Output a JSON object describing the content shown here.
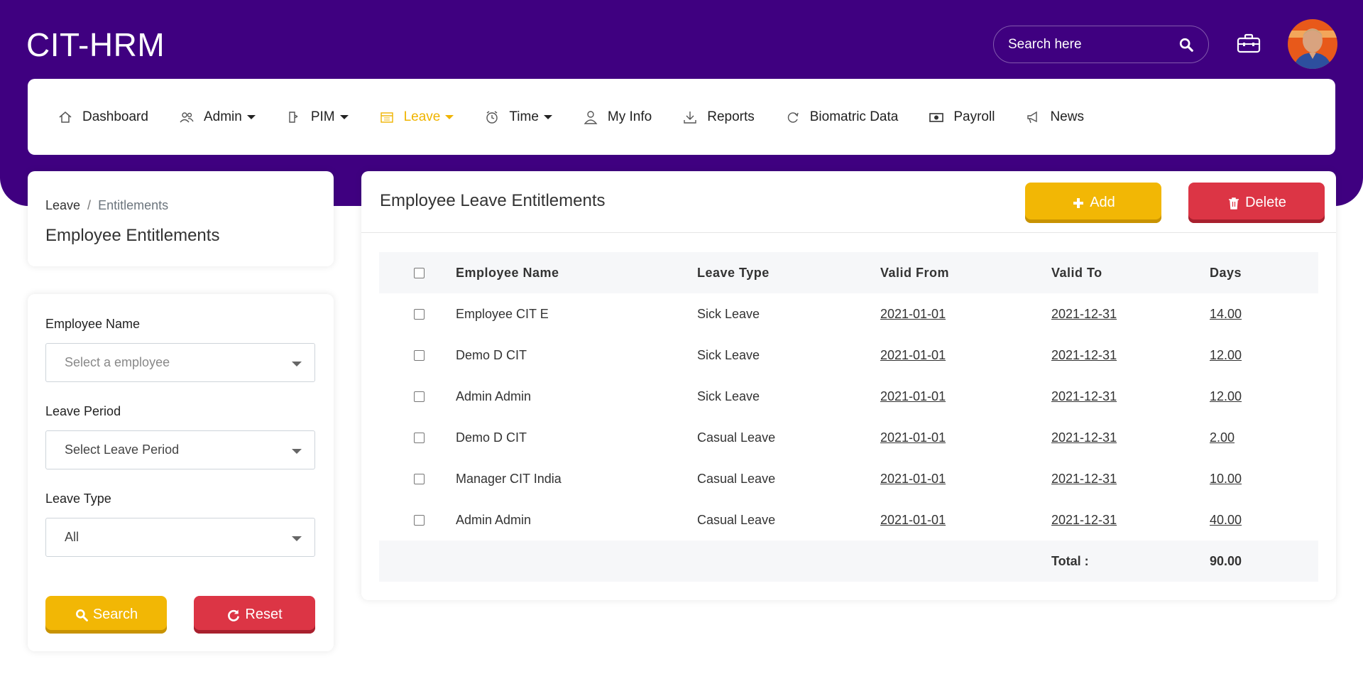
{
  "app": {
    "brand": "CIT-HRM"
  },
  "header": {
    "search_placeholder": "Search here"
  },
  "nav": [
    {
      "label": "Dashboard",
      "icon": "home-icon",
      "dropdown": false,
      "active": false
    },
    {
      "label": "Admin",
      "icon": "users-icon",
      "dropdown": true,
      "active": false
    },
    {
      "label": "PIM",
      "icon": "pim-icon",
      "dropdown": true,
      "active": false
    },
    {
      "label": "Leave",
      "icon": "calendar-icon",
      "dropdown": true,
      "active": true
    },
    {
      "label": "Time",
      "icon": "clock-icon",
      "dropdown": true,
      "active": false
    },
    {
      "label": "My Info",
      "icon": "user-icon",
      "dropdown": false,
      "active": false
    },
    {
      "label": "Reports",
      "icon": "download-icon",
      "dropdown": false,
      "active": false
    },
    {
      "label": "Biomatric Data",
      "icon": "refresh-icon",
      "dropdown": false,
      "active": false
    },
    {
      "label": "Payroll",
      "icon": "money-icon",
      "dropdown": false,
      "active": false
    },
    {
      "label": "News",
      "icon": "megaphone-icon",
      "dropdown": false,
      "active": false
    }
  ],
  "breadcrumb": {
    "parent": "Leave",
    "separator": "/",
    "current": "Entitlements"
  },
  "page_title": "Employee Entitlements",
  "filters": {
    "employee_label": "Employee Name",
    "employee_placeholder": "Select a employee",
    "period_label": "Leave Period",
    "period_value": "Select Leave Period",
    "type_label": "Leave Type",
    "type_value": "All",
    "search_label": "Search",
    "reset_label": "Reset"
  },
  "main": {
    "title": "Employee Leave Entitlements",
    "add_label": "Add",
    "delete_label": "Delete"
  },
  "table": {
    "headers": [
      "Employee Name",
      "Leave Type",
      "Valid From",
      "Valid To",
      "Days"
    ],
    "rows": [
      [
        "Employee CIT E",
        "Sick Leave",
        "2021-01-01",
        "2021-12-31",
        "14.00"
      ],
      [
        "Demo D CIT",
        "Sick Leave",
        "2021-01-01",
        "2021-12-31",
        "12.00"
      ],
      [
        "Admin Admin",
        "Sick Leave",
        "2021-01-01",
        "2021-12-31",
        "12.00"
      ],
      [
        "Demo D CIT",
        "Casual Leave",
        "2021-01-01",
        "2021-12-31",
        "2.00"
      ],
      [
        "Manager CIT India",
        "Casual Leave",
        "2021-01-01",
        "2021-12-31",
        "10.00"
      ],
      [
        "Admin Admin",
        "Casual Leave",
        "2021-01-01",
        "2021-12-31",
        "40.00"
      ]
    ],
    "total_label": "Total :",
    "total_value": "90.00"
  },
  "colors": {
    "header_bg": "#3f0080",
    "accent_yellow": "#f2b705",
    "accent_red": "#dc3545",
    "active_nav": "#f0b400"
  }
}
